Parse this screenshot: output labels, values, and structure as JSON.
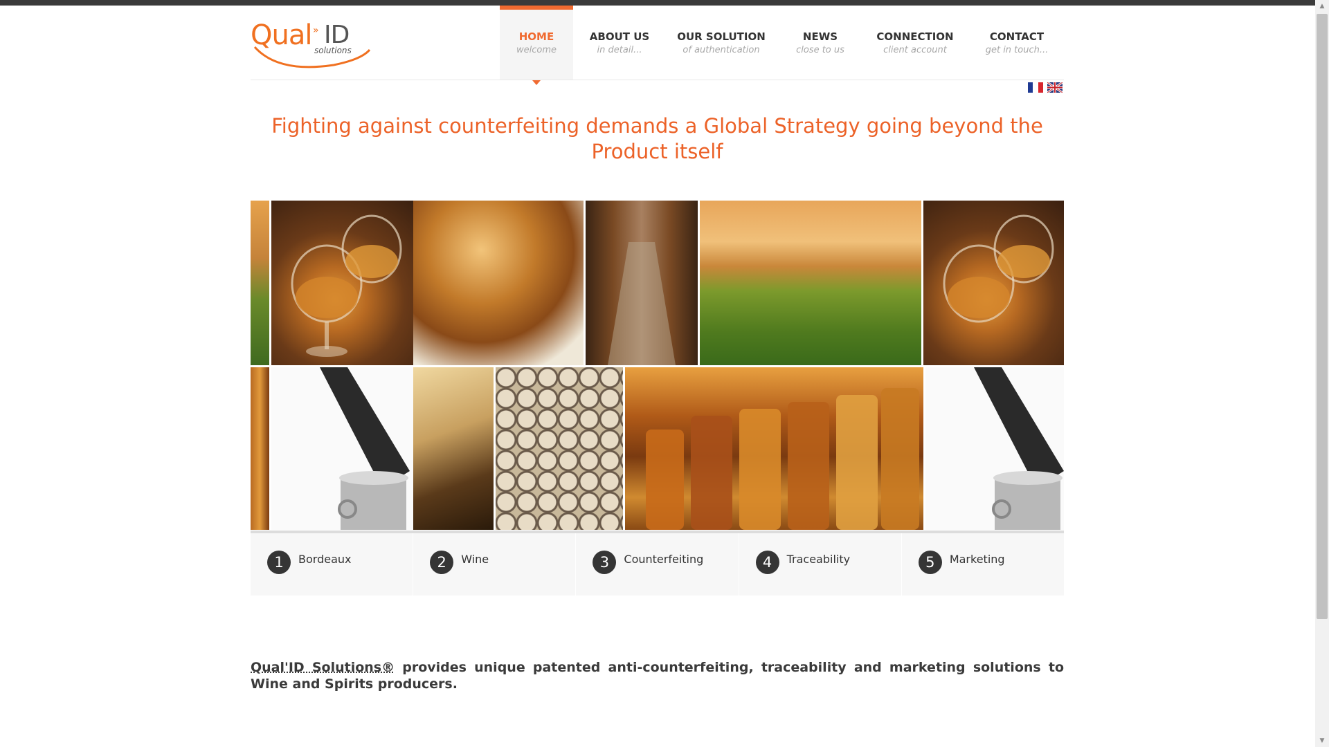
{
  "brand": {
    "logo_text_main": "Qual",
    "logo_text_id": "ID",
    "logo_text_sub": "solutions",
    "logo_mark": "»"
  },
  "nav": [
    {
      "title": "HOME",
      "sub": "welcome",
      "active": true
    },
    {
      "title": "ABOUT US",
      "sub": "in detail..."
    },
    {
      "title": "OUR SOLUTION",
      "sub": "of authentication"
    },
    {
      "title": "NEWS",
      "sub": "close to us"
    },
    {
      "title": "CONNECTION",
      "sub": "client account"
    },
    {
      "title": "CONTACT",
      "sub": "get in touch..."
    }
  ],
  "languages": [
    "fr-flag-icon",
    "uk-flag-icon"
  ],
  "headline": "Fighting against counterfeiting demands a Global Strategy going beyond the Product itself",
  "slides": [
    {
      "num": "1",
      "label": "Bordeaux"
    },
    {
      "num": "2",
      "label": "Wine"
    },
    {
      "num": "3",
      "label": "Counterfeiting"
    },
    {
      "num": "4",
      "label": "Traceability"
    },
    {
      "num": "5",
      "label": "Marketing"
    }
  ],
  "intro": {
    "brand": "Qual'ID Solutions®",
    "text": " provides unique patented anti-counterfeiting, traceability and marketing solutions to Wine and Spirits producers."
  },
  "colors": {
    "accent": "#ec6228",
    "dark": "#353535"
  }
}
